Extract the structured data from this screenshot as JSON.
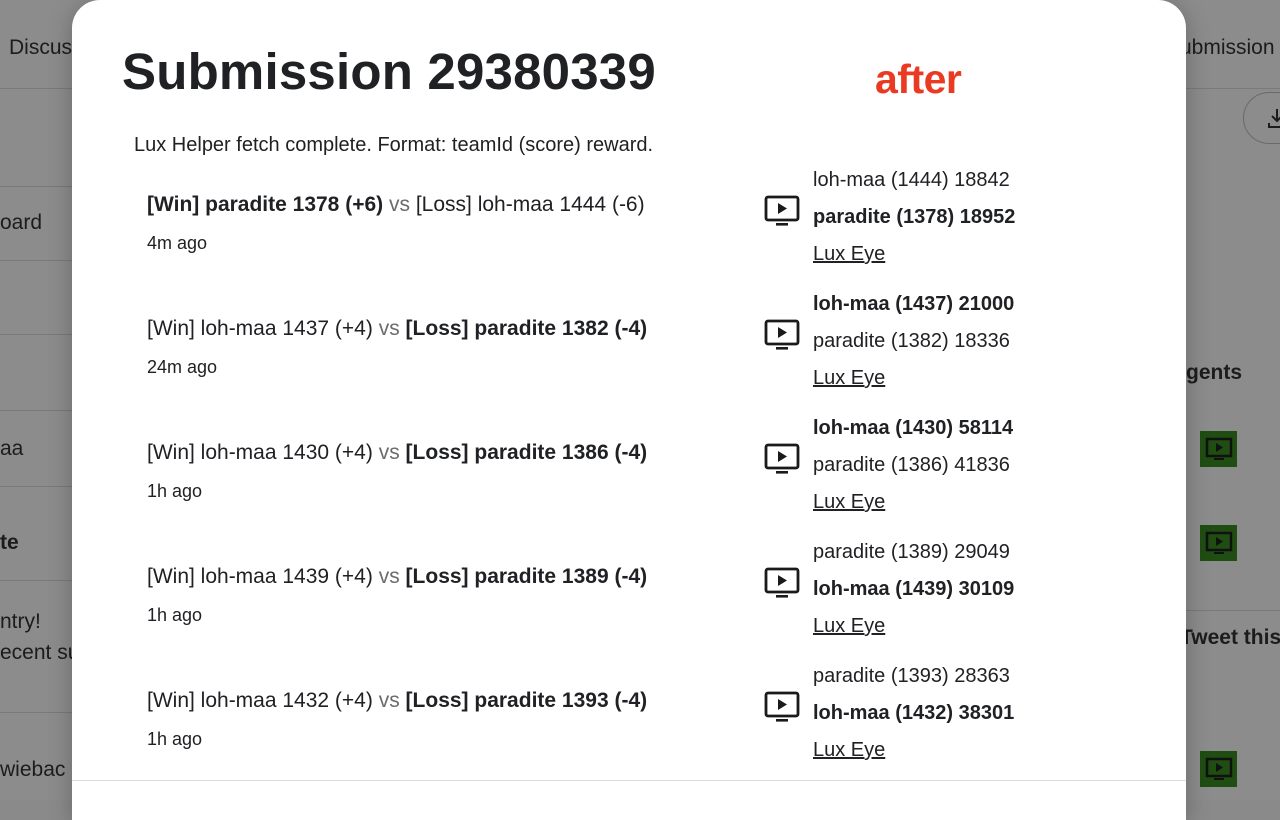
{
  "background": {
    "nav_left": "Discus",
    "nav_right": "ubmission",
    "side_left": [
      "oard",
      "aa",
      "te",
      "ntry!",
      "ecent su",
      "wiebac"
    ],
    "side_right": [
      "gents",
      "Tweet this"
    ],
    "play_color": "#1f4d12"
  },
  "modal": {
    "title": "Submission 29380339",
    "extension_logo": "after",
    "fetch_note": "Lux Helper fetch complete. Format: teamId (score) reward.",
    "matches": [
      {
        "win_label": "[Win] paradite 1378 (+6)",
        "win_bold": true,
        "vs": "vs",
        "loss_label": "[Loss] loh-maa 1444 (-6)",
        "loss_bold": false,
        "time": "4m ago",
        "result_line1": "loh-maa (1444) 18842",
        "line1_bold": false,
        "result_line2": "paradite (1378) 18952",
        "line2_bold": true,
        "eye_label": "Lux Eye"
      },
      {
        "win_label": "[Win] loh-maa 1437 (+4)",
        "win_bold": false,
        "vs": "vs",
        "loss_label": "[Loss] paradite 1382 (-4)",
        "loss_bold": true,
        "time": "24m ago",
        "result_line1": "loh-maa (1437) 21000",
        "line1_bold": true,
        "result_line2": "paradite (1382) 18336",
        "line2_bold": false,
        "eye_label": "Lux Eye"
      },
      {
        "win_label": "[Win] loh-maa 1430 (+4)",
        "win_bold": false,
        "vs": "vs",
        "loss_label": "[Loss] paradite 1386 (-4)",
        "loss_bold": true,
        "time": "1h ago",
        "result_line1": "loh-maa (1430) 58114",
        "line1_bold": true,
        "result_line2": "paradite (1386) 41836",
        "line2_bold": false,
        "eye_label": "Lux Eye"
      },
      {
        "win_label": "[Win] loh-maa 1439 (+4)",
        "win_bold": false,
        "vs": "vs",
        "loss_label": "[Loss] paradite 1389 (-4)",
        "loss_bold": true,
        "time": "1h ago",
        "result_line1": "paradite (1389) 29049",
        "line1_bold": false,
        "result_line2": "loh-maa (1439) 30109",
        "line2_bold": true,
        "eye_label": "Lux Eye"
      },
      {
        "win_label": "[Win] loh-maa 1432 (+4)",
        "win_bold": false,
        "vs": "vs",
        "loss_label": "[Loss] paradite 1393 (-4)",
        "loss_bold": true,
        "time": "1h ago",
        "result_line1": "paradite (1393) 28363",
        "line1_bold": false,
        "result_line2": "loh-maa (1432) 38301",
        "line2_bold": true,
        "eye_label": "Lux Eye"
      }
    ]
  }
}
